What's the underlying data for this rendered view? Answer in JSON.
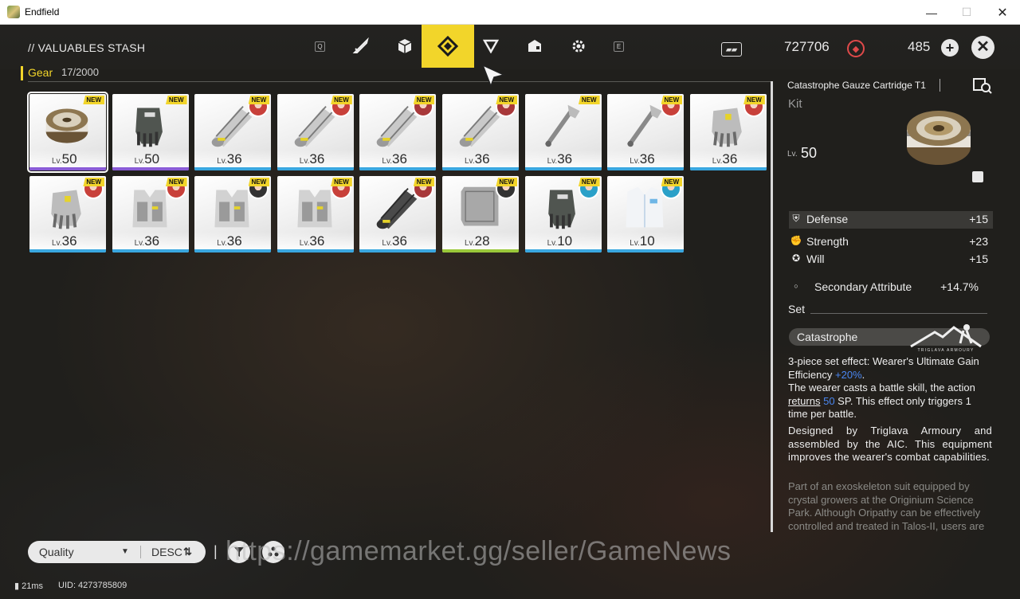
{
  "window": {
    "title": "Endfield",
    "minimize": "—",
    "maximize": "☐",
    "close": "✕"
  },
  "header": {
    "title": "// VALUABLES STASH",
    "category": "Gear",
    "count": "17/2000",
    "tabs": [
      {
        "key": "Q"
      },
      {
        "icon": "sword-icon"
      },
      {
        "icon": "cube-icon"
      },
      {
        "icon": "gear-tab-icon",
        "active": true
      },
      {
        "icon": "triangle-icon"
      },
      {
        "icon": "package-icon"
      },
      {
        "icon": "cog-icon"
      },
      {
        "key": "E"
      }
    ],
    "currency1": {
      "icon": "card-icon",
      "value": "727706"
    },
    "currency2": {
      "icon": "originium-icon",
      "value": "485"
    },
    "plus": "+",
    "close": "✕"
  },
  "items": [
    {
      "level": "50",
      "lv": "Lv.",
      "new": "NEW",
      "rarity": "#8a5cd6",
      "kind": "cartridge",
      "avatar": null,
      "selected": true
    },
    {
      "level": "50",
      "lv": "Lv.",
      "new": "NEW",
      "rarity": "#8a5cd6",
      "kind": "glove-dark",
      "avatar": null
    },
    {
      "level": "36",
      "lv": "Lv.",
      "new": "NEW",
      "rarity": "#3aa7e0",
      "kind": "cylinder",
      "avatar": "#c8403a"
    },
    {
      "level": "36",
      "lv": "Lv.",
      "new": "NEW",
      "rarity": "#3aa7e0",
      "kind": "cylinder",
      "avatar": "#c8403a"
    },
    {
      "level": "36",
      "lv": "Lv.",
      "new": "NEW",
      "rarity": "#3aa7e0",
      "kind": "cylinder",
      "avatar": "#a8383a"
    },
    {
      "level": "36",
      "lv": "Lv.",
      "new": "NEW",
      "rarity": "#3aa7e0",
      "kind": "cylinder",
      "avatar": "#a8383a"
    },
    {
      "level": "36",
      "lv": "Lv.",
      "new": "NEW",
      "rarity": "#3aa7e0",
      "kind": "wrench",
      "avatar": null
    },
    {
      "level": "36",
      "lv": "Lv.",
      "new": "NEW",
      "rarity": "#3aa7e0",
      "kind": "wrench",
      "avatar": "#c8403a"
    },
    {
      "level": "36",
      "lv": "Lv.",
      "new": "NEW",
      "rarity": "#3aa7e0",
      "kind": "glove",
      "avatar": "#c8403a"
    },
    {
      "level": "36",
      "lv": "Lv.",
      "new": "NEW",
      "rarity": "#3aa7e0",
      "kind": "glove",
      "avatar": "#c8403a"
    },
    {
      "level": "36",
      "lv": "Lv.",
      "new": "NEW",
      "rarity": "#3aa7e0",
      "kind": "vest",
      "avatar": "#c8403a"
    },
    {
      "level": "36",
      "lv": "Lv.",
      "new": "NEW",
      "rarity": "#3aa7e0",
      "kind": "vest",
      "avatar": "#333333"
    },
    {
      "level": "36",
      "lv": "Lv.",
      "new": "NEW",
      "rarity": "#3aa7e0",
      "kind": "vest",
      "avatar": "#c8403a"
    },
    {
      "level": "36",
      "lv": "Lv.",
      "new": "NEW",
      "rarity": "#3aa7e0",
      "kind": "cylinder-dark",
      "avatar": "#a8383a"
    },
    {
      "level": "28",
      "lv": "Lv.",
      "new": "NEW",
      "rarity": "#9ac83a",
      "kind": "plate",
      "avatar": "#333333"
    },
    {
      "level": "10",
      "lv": "Lv.",
      "new": "NEW",
      "rarity": "#3aa7e0",
      "kind": "glove-dark",
      "avatar": "#2aa0c8"
    },
    {
      "level": "10",
      "lv": "Lv.",
      "new": "NEW",
      "rarity": "#3aa7e0",
      "kind": "jacket",
      "avatar": "#2aa0c8"
    }
  ],
  "detail": {
    "title": "Catastrophe Gauze Cartridge T1",
    "kind": "Kit",
    "lv_label": "Lv.",
    "level": "50",
    "main_stat": {
      "name": "Defense",
      "value": "+15"
    },
    "stats": [
      {
        "name": "Strength",
        "value": "+23"
      },
      {
        "name": "Will",
        "value": "+15"
      }
    ],
    "secondary": {
      "name": "Secondary Attribute",
      "value": "+14.7%"
    },
    "set_label": "Set",
    "set_name": "Catastrophe",
    "brand": "TRIGLAVA ARMOURY",
    "effect_1": "3-piece set effect: Wearer's Ultimate Gain Efficiency ",
    "effect_1_val": "+20%",
    "effect_1_end": ".",
    "effect_2": "The wearer casts a battle skill, the action ",
    "effect_2_link": "returns",
    "effect_2_val": "50",
    "effect_2_end": " SP. This effect only triggers 1 time per battle.",
    "description": "Designed by Triglava Armoury and assembled by the AIC. This equipment improves the wearer's combat capabilities.",
    "lore": "Part of an exoskeleton suit equipped by crystal growers at the Originium Science Park. Although Oripathy can be effectively controlled and treated in Talos-II, users are still advised to wear basic"
  },
  "bottom": {
    "sort": "Quality",
    "order": "DESC",
    "watermark": "https://gamemarket.gg/seller/GameNews",
    "ping": "21ms",
    "uid": "UID: 4273785809"
  }
}
